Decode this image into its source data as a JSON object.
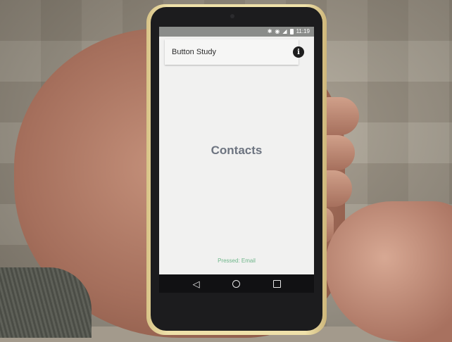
{
  "status_bar": {
    "time": "11:19",
    "icons": [
      "bluetooth-icon",
      "sync-icon",
      "signal-icon",
      "battery-icon"
    ]
  },
  "app_bar": {
    "title": "Button Study",
    "info_icon": "i"
  },
  "main": {
    "heading": "Contacts",
    "status_message": "Pressed: Email"
  },
  "nav_bar": {
    "back_glyph": "◁"
  },
  "colors": {
    "heading": "#6d7480",
    "status_message": "#6fb68a",
    "screen_bg": "#f1f1f0",
    "status_bar_bg": "#8a8c8a"
  }
}
